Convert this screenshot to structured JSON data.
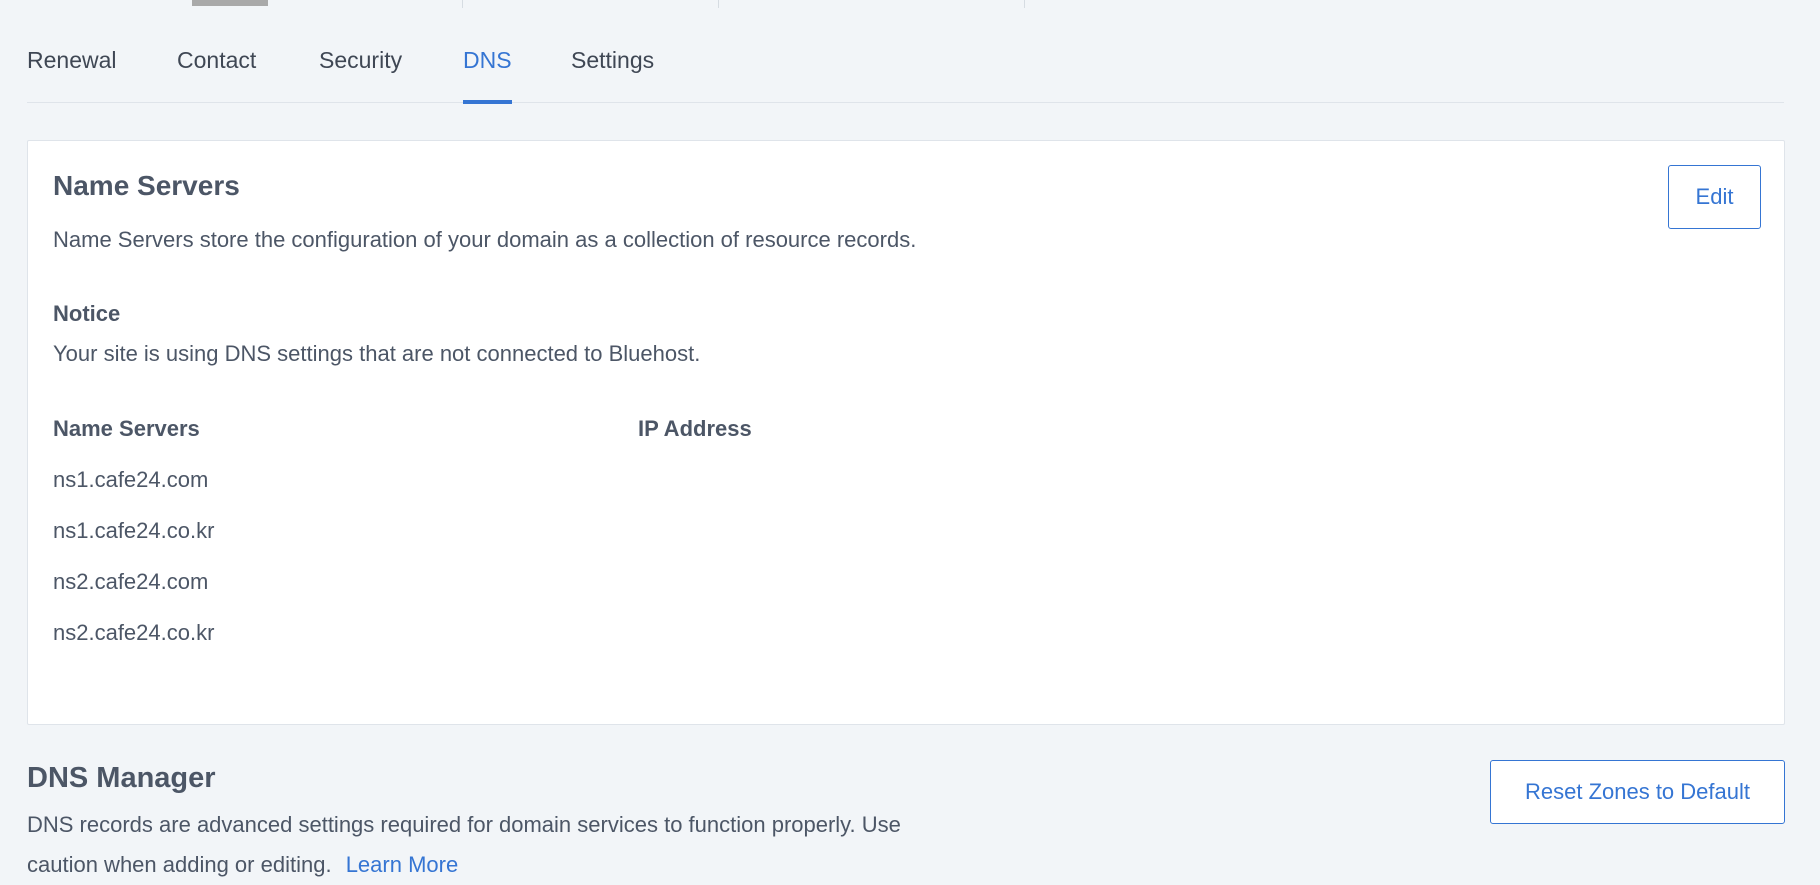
{
  "tabs": [
    {
      "label": "Renewal",
      "active": false
    },
    {
      "label": "Contact",
      "active": false
    },
    {
      "label": "Security",
      "active": false
    },
    {
      "label": "DNS",
      "active": true
    },
    {
      "label": "Settings",
      "active": false
    }
  ],
  "name_servers_card": {
    "title": "Name Servers",
    "description": "Name Servers store the configuration of your domain as a collection of resource records.",
    "edit_label": "Edit",
    "notice_title": "Notice",
    "notice_text": "Your site is using DNS settings that are not connected to Bluehost.",
    "col_name_servers": "Name Servers",
    "col_ip_address": "IP Address",
    "servers": [
      "ns1.cafe24.com",
      "ns1.cafe24.co.kr",
      "ns2.cafe24.com",
      "ns2.cafe24.co.kr"
    ]
  },
  "dns_manager": {
    "title": "DNS Manager",
    "description": "DNS records are advanced settings required for domain services to function properly. Use caution when adding or editing.",
    "learn_more": "Learn More",
    "reset_label": "Reset Zones to Default"
  },
  "colors": {
    "accent": "#3575d3",
    "text": "#4c5666",
    "background": "#f2f5f8"
  }
}
